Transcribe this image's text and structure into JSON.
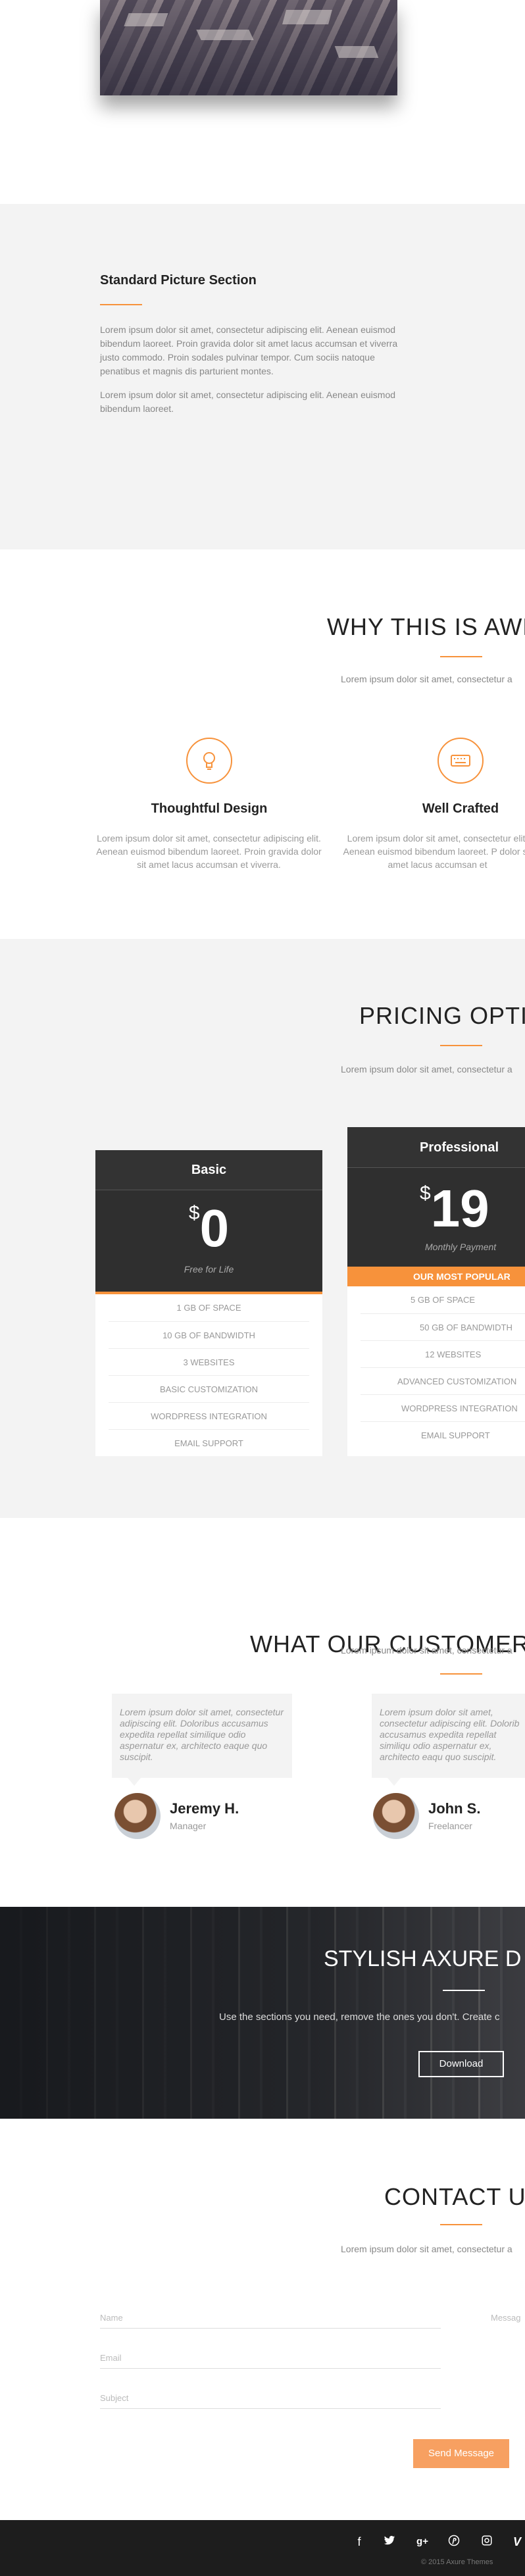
{
  "standard": {
    "title": "Standard Picture Section",
    "p1": "Lorem ipsum dolor sit amet, consectetur adipiscing elit. Aenean euismod bibendum laoreet. Proin gravida dolor sit amet lacus accumsan et viverra justo commodo. Proin sodales pulvinar tempor. Cum sociis natoque penatibus et magnis dis parturient montes.",
    "p2": "Lorem ipsum dolor sit amet, consectetur adipiscing elit. Aenean euismod bibendum laoreet."
  },
  "why": {
    "title": "WHY THIS IS AWE",
    "sub": "Lorem ipsum dolor sit amet, consectetur a",
    "features": [
      {
        "icon": "lightbulb-icon",
        "title": "Thoughtful Design",
        "desc": "Lorem ipsum dolor sit amet, consectetur adipiscing elit. Aenean euismod bibendum laoreet. Proin gravida dolor sit amet lacus accumsan et viverra."
      },
      {
        "icon": "keyboard-icon",
        "title": "Well Crafted",
        "desc": "Lorem ipsum dolor sit amet, consectetur elit. Aenean euismod bibendum laoreet. P dolor sit amet lacus accumsan et"
      }
    ]
  },
  "pricing": {
    "title": "PRICING OPTIC",
    "sub": "Lorem ipsum dolor sit amet, consectetur a",
    "plans": [
      {
        "name": "Basic",
        "currency": "$",
        "amount": "0",
        "note": "Free for Life",
        "features": [
          "1 GB OF SPACE",
          "10 GB OF BANDWIDTH",
          "3 WEBSITES",
          "BASIC CUSTOMIZATION",
          "WORDPRESS INTEGRATION",
          "EMAIL SUPPORT"
        ]
      },
      {
        "name": "Professional",
        "currency": "$",
        "amount": "19",
        "note": "Monthly Payment",
        "badge": "OUR MOST POPULAR",
        "features": [
          "5 GB OF SPACE",
          "50 GB OF BANDWIDTH",
          "12 WEBSITES",
          "ADVANCED CUSTOMIZATION",
          "WORDPRESS INTEGRATION",
          "EMAIL SUPPORT"
        ]
      }
    ]
  },
  "customers": {
    "title": "WHAT OUR CUSTOMERS",
    "sub": "Lorem ipsum dolor sit amet, consectetur a",
    "items": [
      {
        "quote": "Lorem ipsum dolor sit amet, consectetur adipiscing elit. Doloribus accusamus expedita repellat similique odio aspernatur ex, architecto eaque quo suscipit.",
        "name": "Jeremy H.",
        "role": "Manager"
      },
      {
        "quote": "Lorem ipsum dolor sit amet, consectetur adipiscing elit. Dolorib accusamus expedita repellat similiqu odio aspernatur ex, architecto eaqu quo suscipit.",
        "name": "John S.",
        "role": "Freelancer"
      }
    ]
  },
  "banner": {
    "title": "STYLISH AXURE D",
    "sub": "Use the sections you need, remove the ones you don't.  Create c",
    "button": "Download"
  },
  "contact": {
    "title": "CONTACT US",
    "sub": "Lorem ipsum dolor sit amet, consectetur a",
    "name_placeholder": "Name",
    "email_placeholder": "Email",
    "subject_placeholder": "Subject",
    "message_placeholder": "Messag",
    "send": "Send Message"
  },
  "footer": {
    "icons": [
      "facebook-icon",
      "twitter-icon",
      "google-plus-icon",
      "pinterest-icon",
      "instagram-icon",
      "vine-icon"
    ],
    "copyright": "© 2015 Axure Themes"
  },
  "colors": {
    "accent": "#f7923b",
    "dark": "#333333",
    "light_bg": "#f3f3f3"
  }
}
